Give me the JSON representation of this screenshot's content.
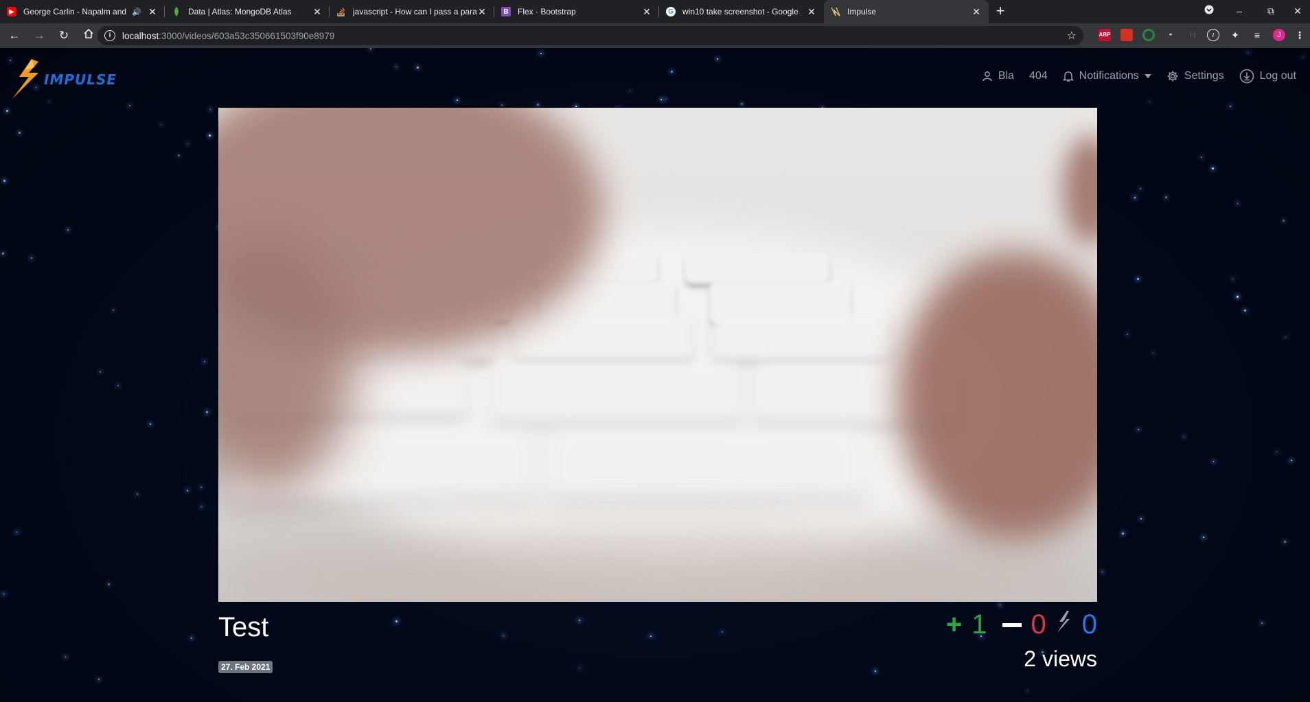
{
  "browser": {
    "tabs": [
      {
        "title": "George Carlin - Napalm and",
        "icon": "youtube-icon",
        "icon_color": "#ff0000",
        "muted": true
      },
      {
        "title": "Data | Atlas: MongoDB Atlas",
        "icon": "mongodb-leaf-icon",
        "icon_color": "#4faa41"
      },
      {
        "title": "javascript - How can I pass a para",
        "icon": "stackoverflow-icon",
        "icon_color": "#f48024"
      },
      {
        "title": "Flex · Bootstrap",
        "icon": "bootstrap-icon",
        "icon_color": "#7952b3",
        "icon_letter": "B"
      },
      {
        "title": "win10 take screenshot - Google",
        "icon": "google-icon",
        "icon_color": "#4285f4",
        "icon_letter": "G"
      },
      {
        "title": "Impulse",
        "icon": "impulse-icon",
        "icon_color": "#f0a33a",
        "active": true
      }
    ],
    "url_host": "localhost",
    "url_rest": ":3000/videos/603a53c350661503f90e8979",
    "profile_initial": "J",
    "extensions": [
      {
        "name": "adblock-plus-icon",
        "label": "ABP",
        "color": "#c70d2c"
      },
      {
        "name": "extension-red-icon",
        "label": "",
        "color": "#d93025"
      },
      {
        "name": "extension-green-ring-icon",
        "label": "",
        "color": "#1e8e3e"
      },
      {
        "name": "extension-glasses-icon",
        "label": "",
        "color": "#5f6368"
      },
      {
        "name": "extension-dim-icon",
        "label": "",
        "color": "#5f6368"
      },
      {
        "name": "extension-compass-icon",
        "label": "",
        "color": "#5f6368"
      }
    ]
  },
  "app": {
    "brand": "IMPULSE",
    "nav": {
      "user": "Bla",
      "link_404": "404",
      "notifications": "Notifications",
      "settings": "Settings",
      "logout": "Log out"
    },
    "video": {
      "title": "Test",
      "date": "27. Feb 2021",
      "upvotes": "1",
      "downvotes": "0",
      "impulses": "0",
      "views": "2 views"
    },
    "colors": {
      "brand_blue": "#1e6fd9",
      "bolt_orange": "#f29a1b",
      "upvote_green": "#28a745",
      "downvote_red": "#dc3545",
      "impulse_blue": "#1e7cf0",
      "nav_gray": "#9aa0a6"
    }
  }
}
